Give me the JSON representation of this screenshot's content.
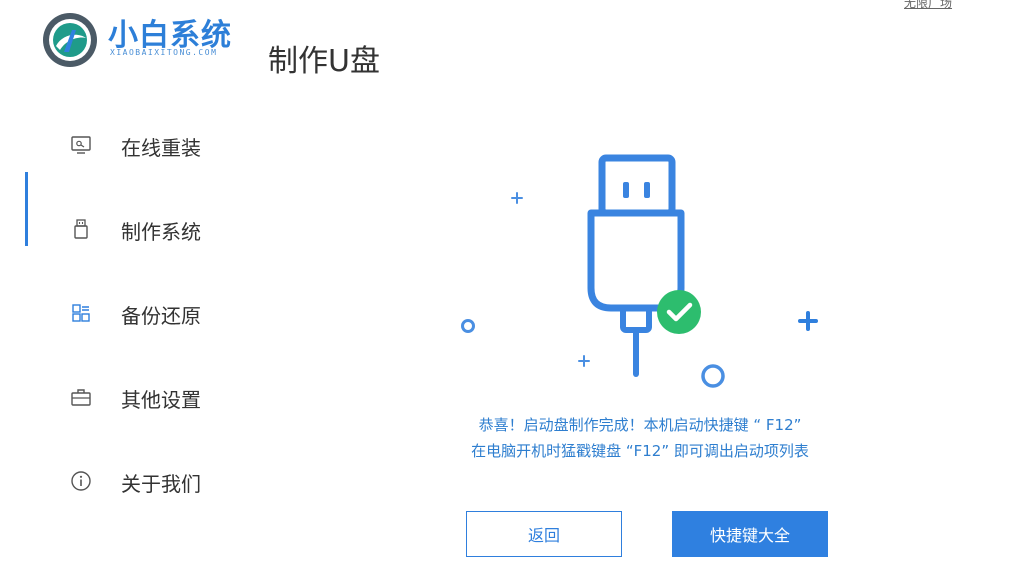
{
  "header": {
    "brand_name": "小白系统",
    "brand_domain": "XIAOBAIXITONG.COM",
    "page_title": "制作U盘",
    "top_corner_text": "无限广场"
  },
  "sidebar": {
    "active_index": 2,
    "items": [
      {
        "label": "在线重装",
        "icon": "monitor-icon"
      },
      {
        "label": "制作系统",
        "icon": "usb-drive-icon"
      },
      {
        "label": "备份还原",
        "icon": "grid-icon"
      },
      {
        "label": "其他设置",
        "icon": "toolbox-icon"
      },
      {
        "label": "关于我们",
        "icon": "info-icon"
      }
    ]
  },
  "main": {
    "illustration": "usb-cable-success-illustration",
    "message_line1": "恭喜！启动盘制作完成！本机启动快捷键 “ F12”",
    "message_line2": "在电脑开机时猛戳键盘 “F12” 即可调出启动项列表",
    "back_button": "返回",
    "shortcut_button": "快捷键大全"
  },
  "colors": {
    "accent": "#2f7fdd",
    "success": "#2dbd6e",
    "text": "#333333"
  }
}
